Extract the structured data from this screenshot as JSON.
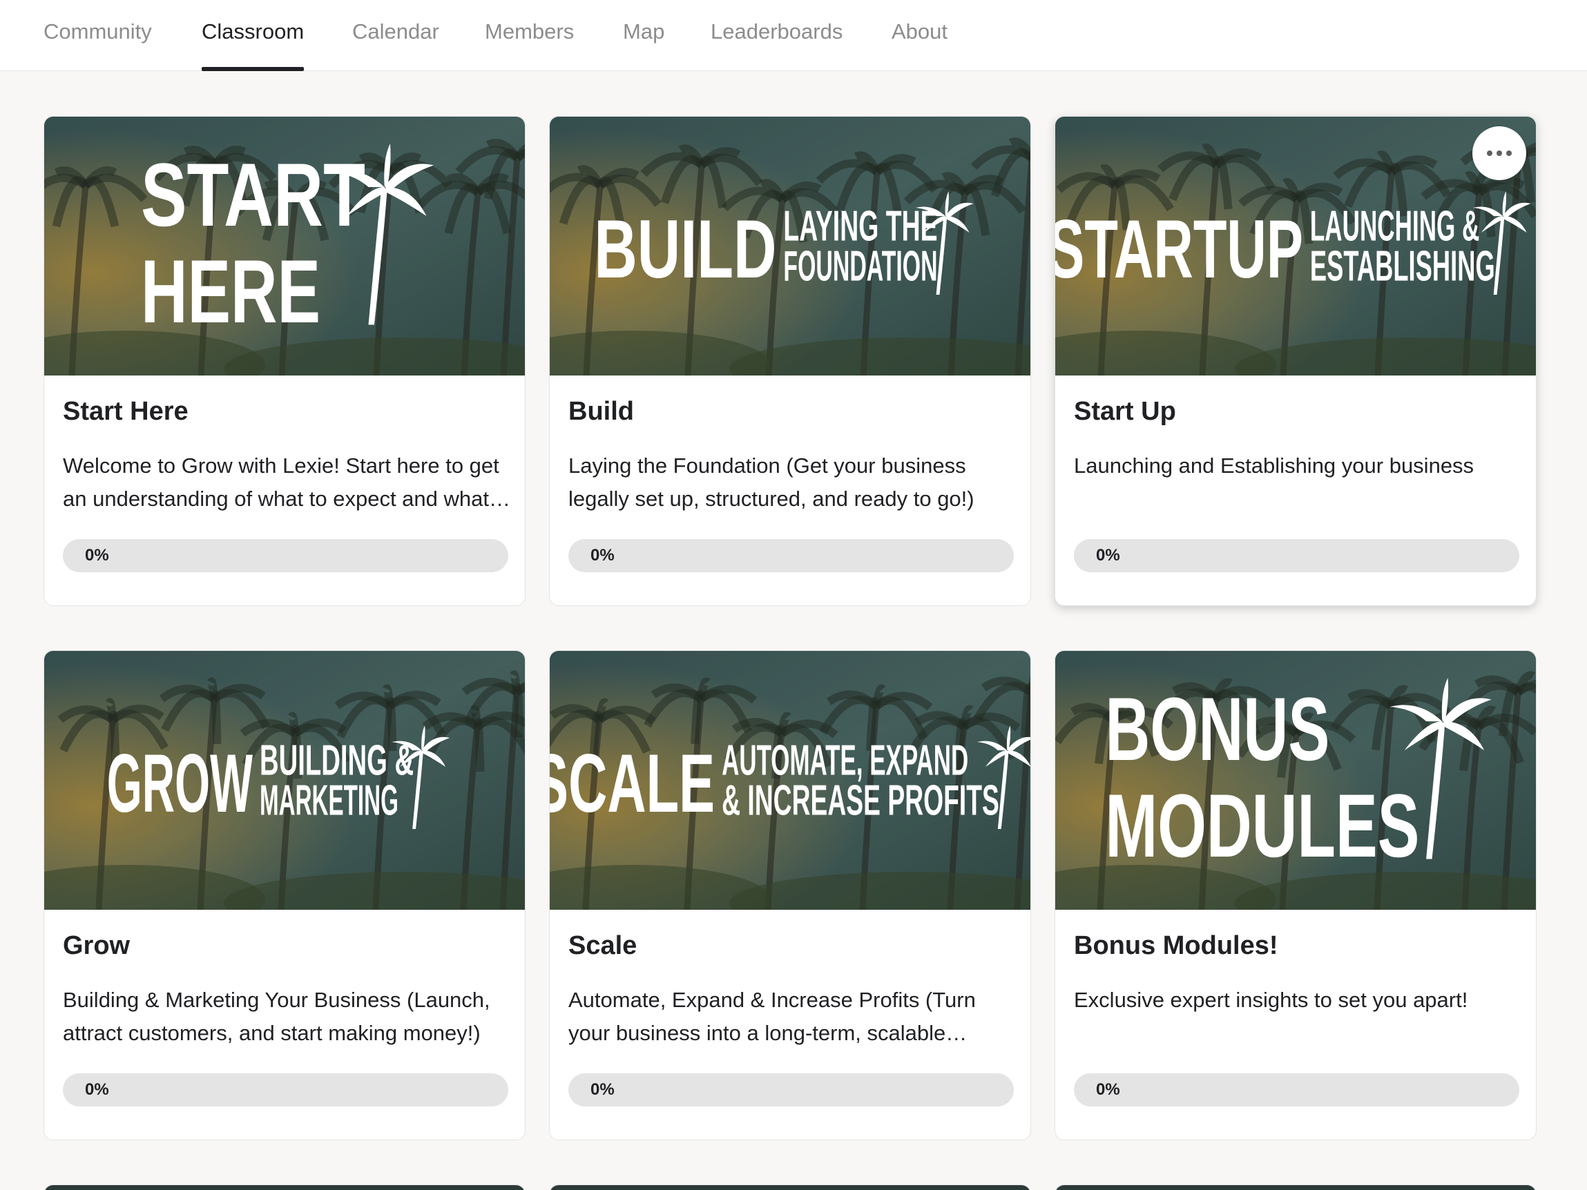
{
  "nav": {
    "tabs": [
      {
        "label": "Community",
        "active": false
      },
      {
        "label": "Classroom",
        "active": true
      },
      {
        "label": "Calendar",
        "active": false
      },
      {
        "label": "Members",
        "active": false
      },
      {
        "label": "Map",
        "active": false
      },
      {
        "label": "Leaderboards",
        "active": false
      },
      {
        "label": "About",
        "active": false
      }
    ]
  },
  "colors": {
    "progress_track": "#e4e4e4",
    "progress_fill": "#f5cc47",
    "text_primary": "#202124",
    "text_muted": "#8c8c8c",
    "page_background": "#f8f7f5"
  },
  "courses": [
    {
      "title": "Start Here",
      "description": "Welcome to Grow with Lexie! Start here to get an understanding of what to expect and what you will gain from this community.",
      "progress_label": "0%",
      "progress": 0,
      "banner": {
        "big": [
          "START",
          "HERE"
        ],
        "small": []
      },
      "menu_icon": "more-horizontal-icon",
      "hover_menu": false
    },
    {
      "title": "Build",
      "description": "Laying the Foundation (Get your business legally set up, structured, and ready to go!)",
      "progress_label": "0%",
      "progress": 0,
      "banner": {
        "big": [
          "BUILD"
        ],
        "small": [
          "LAYING THE",
          "FOUNDATION"
        ]
      },
      "menu_icon": "more-horizontal-icon",
      "hover_menu": false
    },
    {
      "title": "Start Up",
      "description": "Launching and Establishing your business",
      "progress_label": "0%",
      "progress": 0,
      "banner": {
        "big": [
          "STARTUP"
        ],
        "small": [
          "LAUNCHING &",
          "ESTABLISHING"
        ]
      },
      "menu_icon": "more-horizontal-icon",
      "hover_menu": true
    },
    {
      "title": "Grow",
      "description": "Building & Marketing Your Business (Launch, attract customers, and start making money!)",
      "progress_label": "0%",
      "progress": 0,
      "banner": {
        "big": [
          "GROW"
        ],
        "small": [
          "BUILDING &",
          "MARKETING"
        ]
      },
      "menu_icon": "more-horizontal-icon",
      "hover_menu": false
    },
    {
      "title": "Scale",
      "description": "Automate, Expand & Increase Profits (Turn your business into a long-term, scalable success!)",
      "progress_label": "0%",
      "progress": 0,
      "banner": {
        "big": [
          "SCALE"
        ],
        "small": [
          "AUTOMATE, EXPAND",
          "& INCREASE PROFITS"
        ]
      },
      "menu_icon": "more-horizontal-icon",
      "hover_menu": false
    },
    {
      "title": "Bonus Modules!",
      "description": "Exclusive expert insights to set you apart!",
      "progress_label": "0%",
      "progress": 0,
      "banner": {
        "big": [
          "BONUS",
          "MODULES"
        ],
        "small": []
      },
      "menu_icon": "more-horizontal-icon",
      "hover_menu": false
    }
  ]
}
